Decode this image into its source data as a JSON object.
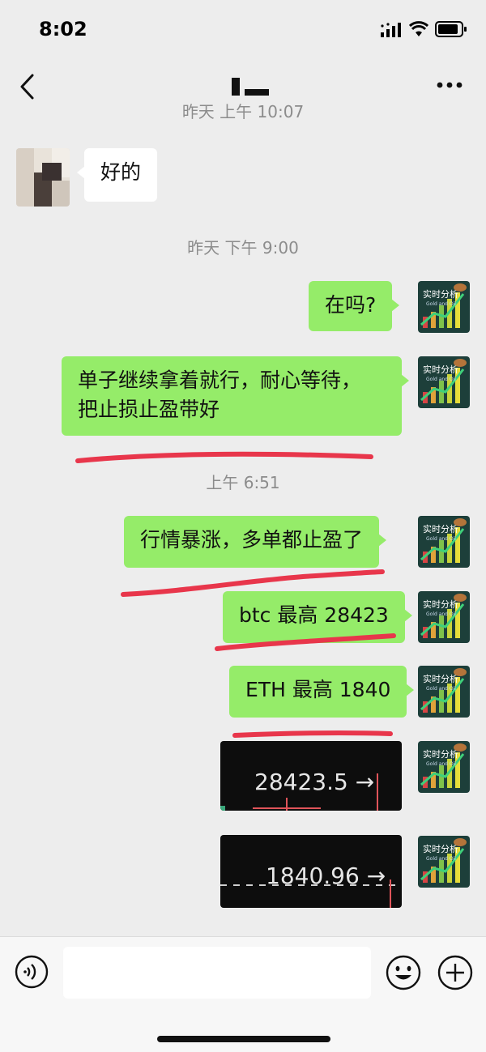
{
  "status_bar": {
    "time": "8:02"
  },
  "nav": {
    "title": ""
  },
  "timestamps": {
    "cut_top": "昨天 上午 10:07",
    "yesterday_pm": "昨天 下午 9:00",
    "morning": "上午 6:51"
  },
  "messages": [
    {
      "from": "peer",
      "text": "好的"
    },
    {
      "from": "self",
      "text": "在吗?"
    },
    {
      "from": "self",
      "line1": "单子继续拿着就行，耐心等待，",
      "line2": "把止损止盈带好"
    },
    {
      "from": "self",
      "text": "行情暴涨，多单都止盈了"
    },
    {
      "from": "self",
      "text": "btc 最高 28423"
    },
    {
      "from": "self",
      "text": "ETH 最高 1840"
    },
    {
      "from": "self",
      "image_text": "28423.5 →"
    },
    {
      "from": "self",
      "image_text": "1840.96 →"
    }
  ],
  "avatar_self": {
    "line1": "实时分析",
    "line2": "Gold and Oil"
  },
  "colors": {
    "bubble_self": "#95ec69",
    "bubble_peer": "#ffffff",
    "background": "#ededed",
    "underline": "#e8364b"
  },
  "icons": {
    "back": "chevron-left-icon",
    "more": "ellipsis-icon",
    "voice": "voice-icon",
    "emoji": "emoji-icon",
    "plus": "plus-icon"
  }
}
